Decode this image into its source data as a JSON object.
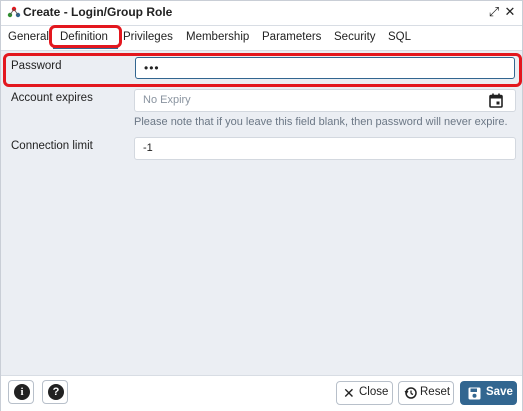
{
  "window": {
    "title": "Create - Login/Group Role",
    "expand_icon": "expand-icon",
    "close_icon": "close-icon"
  },
  "tabs": [
    {
      "label": "General"
    },
    {
      "label": "Definition"
    },
    {
      "label": "Privileges"
    },
    {
      "label": "Membership"
    },
    {
      "label": "Parameters"
    },
    {
      "label": "Security"
    },
    {
      "label": "SQL"
    }
  ],
  "active_tab": "Definition",
  "form": {
    "password": {
      "label": "Password",
      "value": "•••"
    },
    "account_expires": {
      "label": "Account expires",
      "placeholder": "No Expiry",
      "hint": "Please note that if you leave this field blank, then password will never expire."
    },
    "connection_limit": {
      "label": "Connection limit",
      "value": "-1"
    }
  },
  "footer": {
    "info_icon": "info-icon",
    "help_icon": "help-icon",
    "close_label": "Close",
    "reset_label": "Reset",
    "save_label": "Save"
  },
  "colors": {
    "accent": "#326690",
    "highlight": "#e3171e",
    "form_bg": "#ebeef3"
  }
}
